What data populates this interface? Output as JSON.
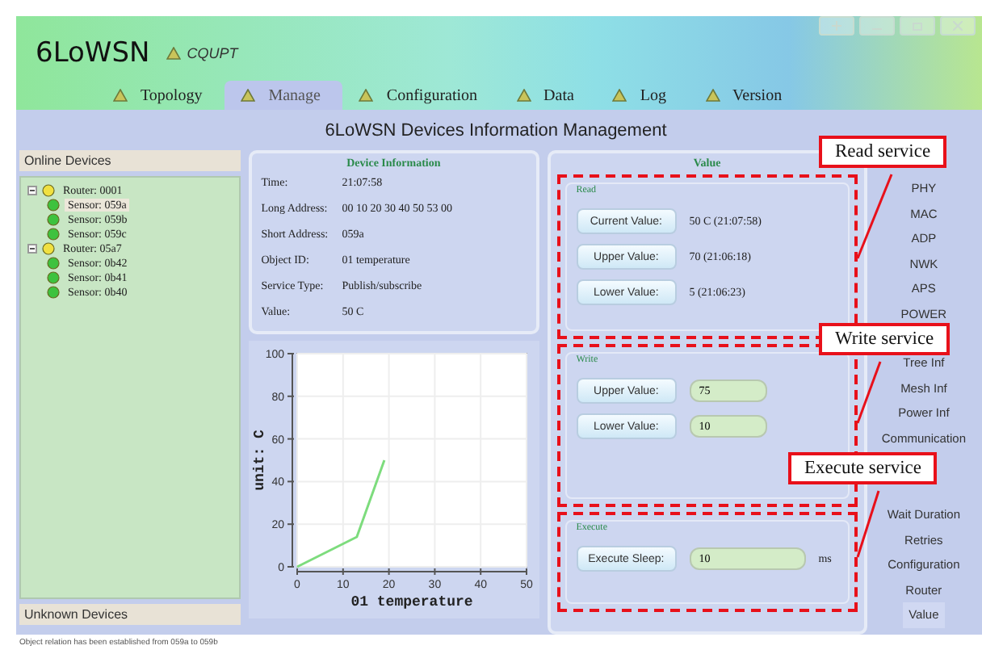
{
  "window": {
    "title": "6LoWSN",
    "subtitle": "CQUPT"
  },
  "tabs": [
    {
      "label": "Topology",
      "selected": false
    },
    {
      "label": "Manage",
      "selected": true
    },
    {
      "label": "Configuration",
      "selected": false
    },
    {
      "label": "Data",
      "selected": false
    },
    {
      "label": "Log",
      "selected": false
    },
    {
      "label": "Version",
      "selected": false
    }
  ],
  "page_title": "6LoWSN Devices Information Management",
  "sidebar": {
    "header": "Online Devices",
    "footer": "Unknown Devices",
    "tree": [
      {
        "label": "Router: 0001",
        "kind": "router",
        "expanded": true,
        "selected": false,
        "children": [
          {
            "label": "Sensor: 059a",
            "kind": "sensor",
            "selected": true
          },
          {
            "label": "Sensor: 059b",
            "kind": "sensor",
            "selected": false
          },
          {
            "label": "Sensor: 059c",
            "kind": "sensor",
            "selected": false
          }
        ]
      },
      {
        "label": "Router: 05a7",
        "kind": "router",
        "expanded": true,
        "selected": false,
        "children": [
          {
            "label": "Sensor: 0b42",
            "kind": "sensor",
            "selected": false
          },
          {
            "label": "Sensor: 0b41",
            "kind": "sensor",
            "selected": false
          },
          {
            "label": "Sensor: 0b40",
            "kind": "sensor",
            "selected": false
          }
        ]
      }
    ]
  },
  "device_info": {
    "title": "Device Information",
    "fields": [
      {
        "label": "Time:",
        "value": "21:07:58"
      },
      {
        "label": "Long Address:",
        "value": "00 10 20 30 40 50 53 00"
      },
      {
        "label": "Short Address:",
        "value": "059a"
      },
      {
        "label": "Object ID:",
        "value": "01 temperature"
      },
      {
        "label": "Service Type:",
        "value": "Publish/subscribe"
      },
      {
        "label": "Value:",
        "value": "50 C"
      }
    ]
  },
  "chart": {
    "chart_data": {
      "type": "line",
      "xlabel": "01 temperature",
      "ylabel": "unit: C",
      "x": [
        0,
        13,
        19
      ],
      "series": [
        {
          "color": "#7ddc7d",
          "values": [
            0,
            14,
            50
          ]
        }
      ],
      "grid": true,
      "xlim": [
        0,
        50
      ],
      "ylim": [
        0,
        100
      ],
      "xticks": [
        0,
        10,
        20,
        30,
        40,
        50
      ],
      "yticks": [
        0,
        20,
        40,
        60,
        80,
        100
      ]
    }
  },
  "value_panel": {
    "title": "Value",
    "sections": [
      {
        "kind": "read",
        "title": "Read",
        "rows": [
          {
            "button": "Current Value:",
            "value": "50 C  (21:07:58)"
          },
          {
            "button": "Upper Value:",
            "value": "70  (21:06:18)"
          },
          {
            "button": "Lower Value:",
            "value": "5  (21:06:23)"
          }
        ]
      },
      {
        "kind": "write",
        "title": "Write",
        "rows": [
          {
            "button": "Upper Value:",
            "value": "75"
          },
          {
            "button": "Lower Value:",
            "value": "10"
          }
        ]
      },
      {
        "kind": "execute",
        "title": "Execute",
        "rows": [
          {
            "button": "Execute Sleep:",
            "value": "10",
            "unit": "ms"
          }
        ]
      }
    ]
  },
  "nav": [
    {
      "items": [
        {
          "label": "PHY"
        },
        {
          "label": "MAC"
        },
        {
          "label": "ADP"
        },
        {
          "label": "NWK"
        },
        {
          "label": "APS"
        },
        {
          "label": "POWER"
        }
      ]
    },
    {
      "items": [
        {
          "label": "Tree Inf"
        },
        {
          "label": "Mesh Inf"
        },
        {
          "label": "Power Inf"
        },
        {
          "label": "Communication"
        }
      ]
    },
    {
      "items": [
        {
          "label": "Wait Duration"
        },
        {
          "label": "Retries"
        },
        {
          "label": "Configuration"
        },
        {
          "label": "Router"
        },
        {
          "label": "Value",
          "selected": true
        }
      ]
    }
  ],
  "annotations": [
    "Read service",
    "Write service",
    "Execute service"
  ],
  "status_bar": "Object relation has been established from 059a to 059b"
}
